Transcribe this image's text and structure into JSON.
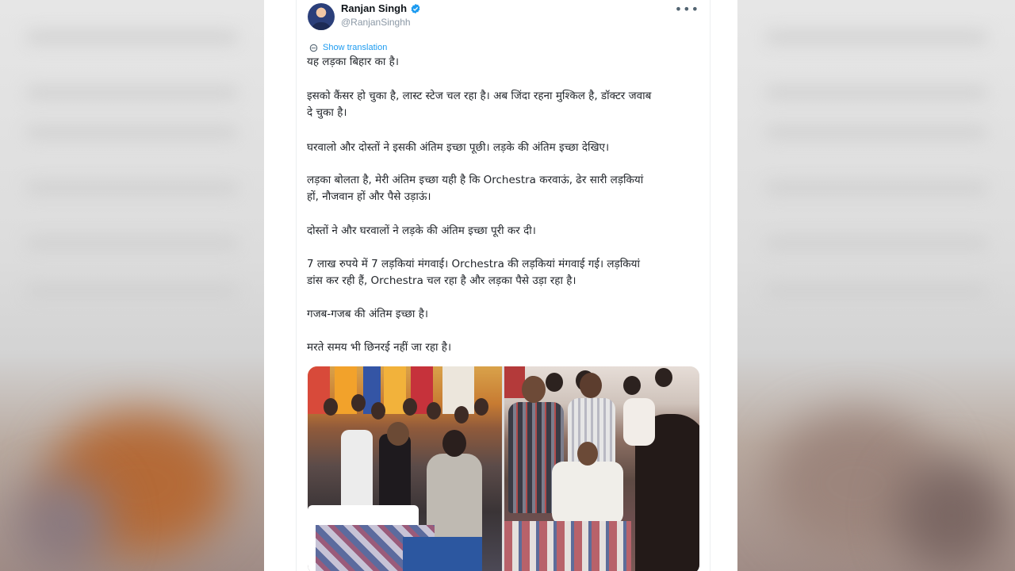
{
  "tweet": {
    "author_name": "Ranjan Singh",
    "author_handle": "@RanjanSinghh",
    "more_icon": "more-horizontal-icon",
    "translate_label": "Show translation",
    "paragraphs": [
      [
        "यह लड़का बिहार का है।"
      ],
      [
        "इसको कैंसर हो चुका है, लास्ट स्टेज चल रहा है। अब जिंदा रहना मुश्किल है, डॉक्टर जवाब",
        "दे चुका है।"
      ],
      [
        "घरवालो और दोस्तों ने इसकी अंतिम इच्छा पूछी। लड़के की अंतिम इच्छा देखिए।"
      ],
      [
        "लड़का बोलता है, मेरी अंतिम इच्छा यही है कि Orchestra करवाऊं, ढेर सारी लड़कियां",
        "हों, नौजवान हों और पैसे उड़ाऊं।"
      ],
      [
        "दोस्तों ने और घरवालों ने लड़के की अंतिम इच्छा पूरी कर दी।"
      ],
      [
        "7 लाख रुपये में 7 लड़कियां मंगवाई। Orchestra की लड़कियां मंगवाई गई। लड़कियां",
        "डांस कर रही हैं, Orchestra चल रहा है और लड़का पैसे उड़ा रहा है।"
      ],
      [
        "गजब-गजब की अंतिम इच्छा है।"
      ],
      [
        "मरते समय भी छिनरई नहीं जा रहा है।"
      ]
    ]
  },
  "colors": {
    "accent": "#1d9bf0",
    "text": "#0f1419",
    "muted": "#8b98a5"
  }
}
